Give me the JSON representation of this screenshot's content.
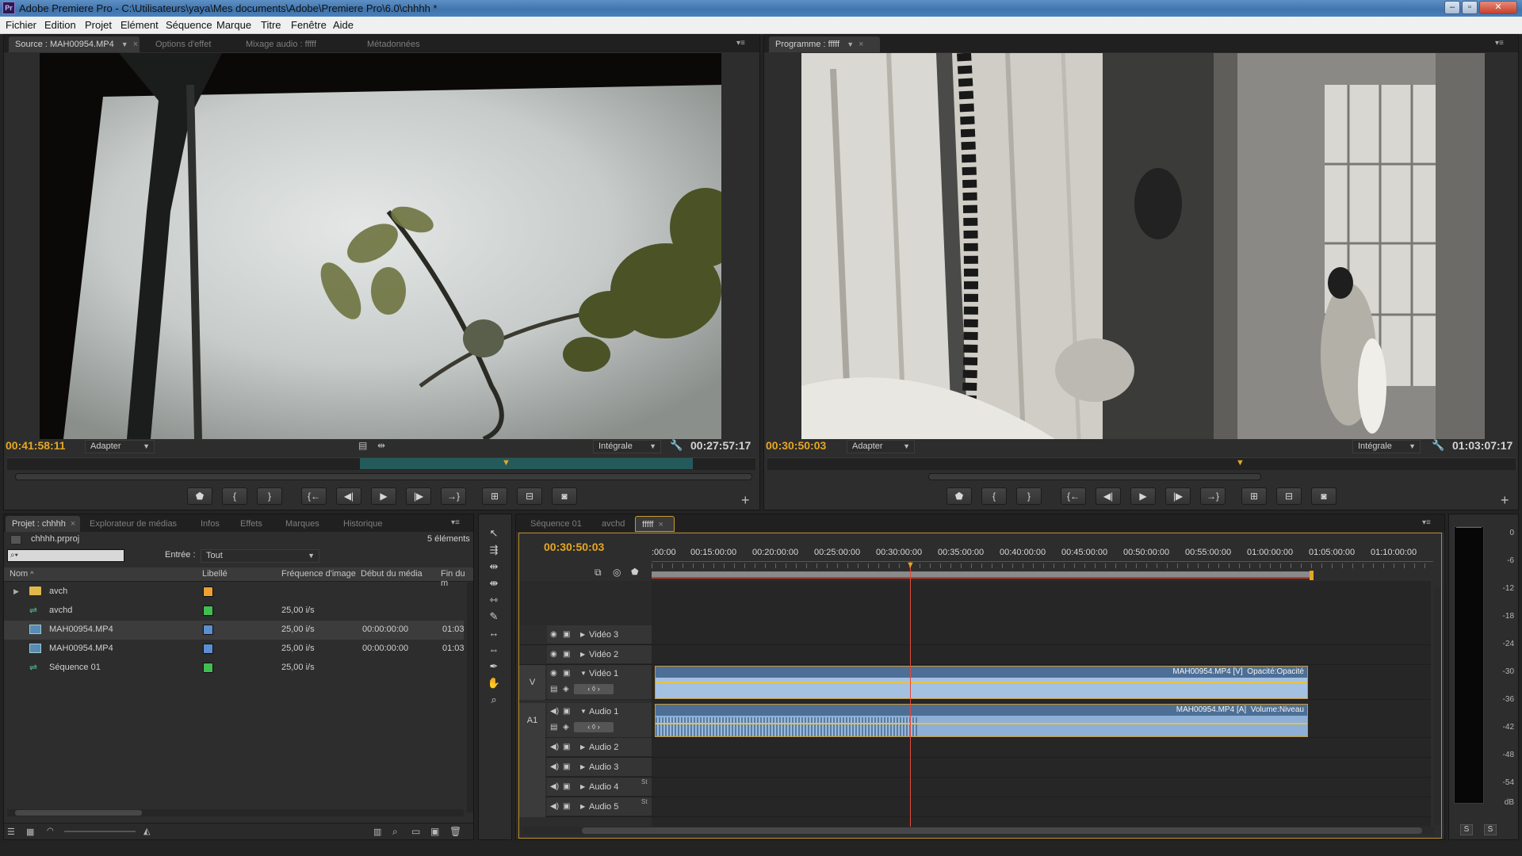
{
  "window": {
    "app_icon": "Pr",
    "title": "Adobe Premiere Pro - C:\\Utilisateurs\\yaya\\Mes documents\\Adobe\\Premiere Pro\\6.0\\chhhh *"
  },
  "menu": [
    "Fichier",
    "Edition",
    "Projet",
    "Elément",
    "Séquence",
    "Marque",
    "Titre",
    "Fenêtre",
    "Aide"
  ],
  "source_panel": {
    "tabs": [
      "Source : MAH00954.MP4",
      "Options d'effet",
      "Mixage audio : fffff",
      "Métadonnées"
    ],
    "timecode": "00:41:58:11",
    "fit": "Adapter",
    "quality": "Intégrale",
    "duration": "00:27:57:17"
  },
  "program_panel": {
    "tab": "Programme : fffff",
    "timecode": "00:30:50:03",
    "fit": "Adapter",
    "quality": "Intégrale",
    "duration": "01:03:07:17"
  },
  "project_panel": {
    "tabs": [
      "Projet : chhhh",
      "Explorateur de médias",
      "Infos",
      "Effets",
      "Marques",
      "Historique"
    ],
    "file": "chhhh.prproj",
    "count": "5 éléments",
    "entry_label": "Entrée :",
    "entry_value": "Tout",
    "columns": [
      "Nom",
      "Libellé",
      "Fréquence d'image",
      "Début du média",
      "Fin du m"
    ],
    "items": [
      {
        "name": "avch",
        "color": "#f0a030",
        "fps": "",
        "start": "",
        "end": ""
      },
      {
        "name": "avchd",
        "color": "#3fbf4f",
        "fps": "25,00 i/s",
        "start": "",
        "end": ""
      },
      {
        "name": "MAH00954.MP4",
        "color": "#5b8fd2",
        "fps": "25,00 i/s",
        "start": "00:00:00:00",
        "end": "01:03"
      },
      {
        "name": "MAH00954.MP4",
        "color": "#5b8fd2",
        "fps": "25,00 i/s",
        "start": "00:00:00:00",
        "end": "01:03"
      },
      {
        "name": "Séquence 01",
        "color": "#3fbf4f",
        "fps": "25,00 i/s",
        "start": "",
        "end": ""
      }
    ]
  },
  "timeline": {
    "tabs": [
      "Séquence 01",
      "avchd",
      "fffff"
    ],
    "timecode": "00:30:50:03",
    "ruler": [
      ":00:00",
      "00:15:00:00",
      "00:20:00:00",
      "00:25:00:00",
      "00:30:00:00",
      "00:35:00:00",
      "00:40:00:00",
      "00:45:00:00",
      "00:50:00:00",
      "00:55:00:00",
      "01:00:00:00",
      "01:05:00:00",
      "01:10:00:00"
    ],
    "video_tracks": [
      "Vidéo 3",
      "Vidéo 2",
      "Vidéo 1"
    ],
    "audio_tracks": [
      "Audio 1",
      "Audio 2",
      "Audio 3",
      "Audio 4",
      "Audio 5"
    ],
    "target_v": "V",
    "target_a": "A1",
    "video_clip": "MAH00954.MP4 [V]  Opacité:Opacité",
    "audio_clip": "MAH00954.MP4 [A]  Volume:Niveau",
    "stereo_tag": "St"
  },
  "meter": {
    "scale": [
      "0",
      "-6",
      "-12",
      "-18",
      "-24",
      "-30",
      "-36",
      "-42",
      "-48",
      "-54",
      "dB"
    ],
    "solo": "S"
  }
}
